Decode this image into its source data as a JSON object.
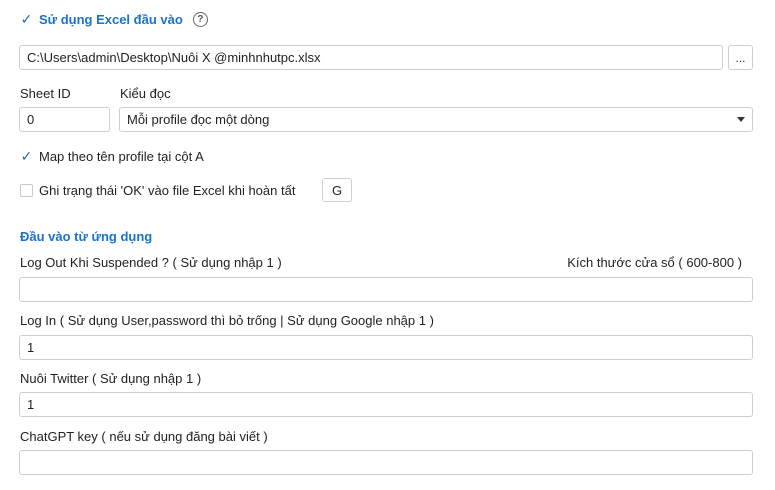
{
  "excel": {
    "use_excel_label": "Sử dụng Excel đầu vào",
    "use_excel_checked": true,
    "help_symbol": "?",
    "file_path": "C:\\Users\\admin\\Desktop\\Nuôi X @minhnhutpc.xlsx",
    "browse_label": "...",
    "sheet_id_label": "Sheet ID",
    "sheet_id_value": "0",
    "read_mode_label": "Kiểu đọc",
    "read_mode_value": "Mỗi profile đọc một dòng",
    "map_label": "Map theo tên profile tại cột A",
    "map_checked": true,
    "write_ok_label": "Ghi trạng thái 'OK' vào file Excel khi hoàn tất",
    "write_ok_checked": false,
    "column_value": "G"
  },
  "app_input": {
    "section_title": "Đầu vào từ ứng dụng",
    "logout_label": "Log Out Khi Suspended ? ( Sử dụng nhập 1 )",
    "window_size_label": "Kích thước cửa sổ ( 600-800 )",
    "logout_value": "",
    "login_label": "Log In ( Sử dụng User,password thì bỏ trống | Sử dụng Google nhập 1 )",
    "login_value": "1",
    "twitter_label": "Nuôi Twitter ( Sử dụng nhập 1 )",
    "twitter_value": "1",
    "chatgpt_label": "ChatGPT key ( nếu sử dụng đăng bài viết )",
    "chatgpt_value": ""
  },
  "colors": {
    "accent": "#1a73c8",
    "check": "#1a66c9",
    "border": "#cfcfcf"
  }
}
